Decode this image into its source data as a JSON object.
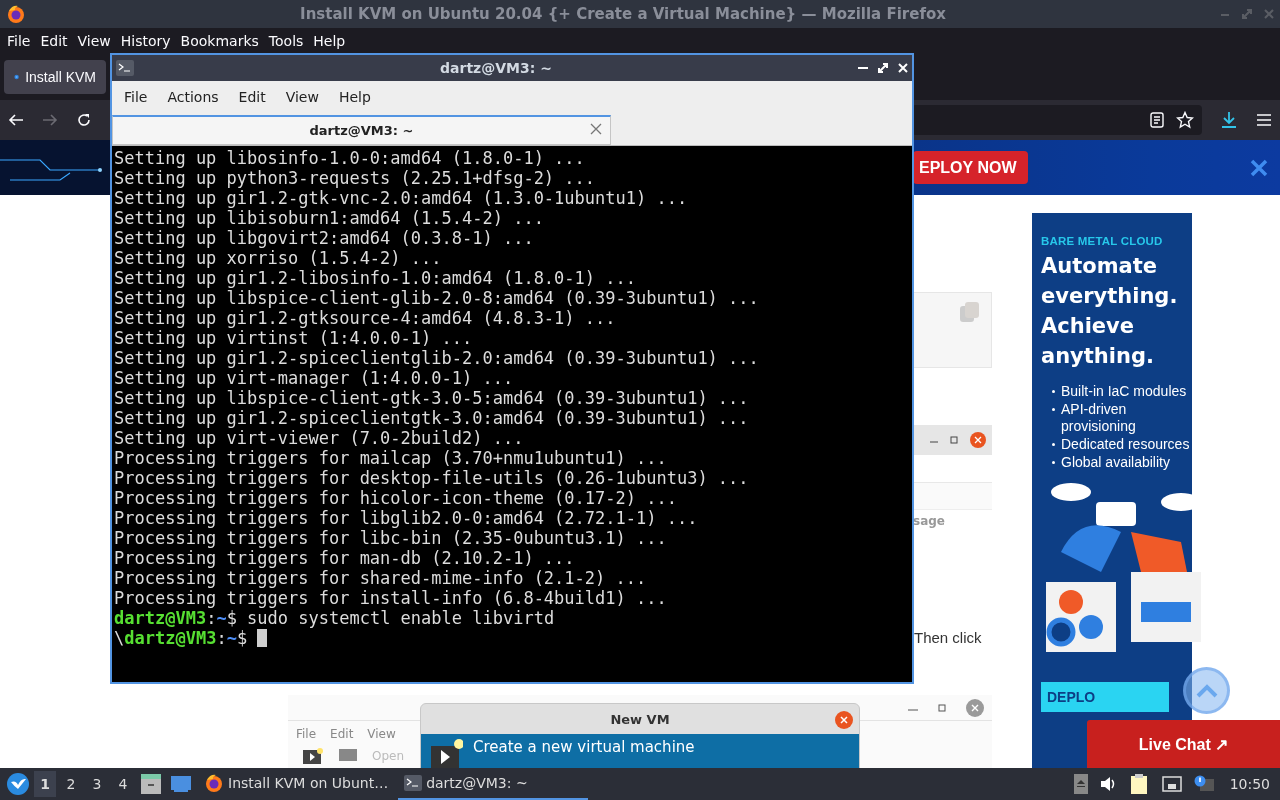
{
  "browser": {
    "title": "Install KVM on Ubuntu 20.04 {+ Create a Virtual Machine} — Mozilla Firefox",
    "menu": [
      "File",
      "Edit",
      "View",
      "History",
      "Bookmarks",
      "Tools",
      "Help"
    ],
    "tabs": [
      {
        "label": "Install KVM",
        "selected": true
      }
    ],
    "nav_buttons": [
      {
        "kind": "back",
        "disabled": false
      },
      {
        "kind": "forward",
        "disabled": true
      },
      {
        "kind": "reload",
        "disabled": false
      }
    ],
    "page": {
      "banner": {
        "button": "EPLOY NOW"
      },
      "article": {
        "partial_word": "sage",
        "partial_sentence": "Then click",
        "screenshot": {
          "menu": [
            "File",
            "Edit",
            "View"
          ],
          "toolbar_label": "Open",
          "dialog": {
            "title": "New VM",
            "option": "Create a new virtual machine"
          }
        }
      },
      "ad": {
        "eyebrow": "BARE METAL CLOUD",
        "headline": "Automate everything. Achieve anything.",
        "bullets": [
          "Built-in IaC modules",
          "API-driven provisioning",
          "Dedicated resources",
          "Global availability"
        ],
        "button": "DEPLO"
      },
      "live_chat": "Live Chat ↗"
    }
  },
  "terminal": {
    "title": "dartz@VM3: ~",
    "menu": [
      "File",
      "Actions",
      "Edit",
      "View",
      "Help"
    ],
    "tabs": [
      {
        "label": "dartz@VM3: ~",
        "selected": true
      }
    ],
    "lines": [
      {
        "kind": "output",
        "text": "Setting up libosinfo-1.0-0:amd64 (1.8.0-1) ..."
      },
      {
        "kind": "output",
        "text": "Setting up python3-requests (2.25.1+dfsg-2) ..."
      },
      {
        "kind": "output",
        "text": "Setting up gir1.2-gtk-vnc-2.0:amd64 (1.3.0-1ubuntu1) ..."
      },
      {
        "kind": "output",
        "text": "Setting up libisoburn1:amd64 (1.5.4-2) ..."
      },
      {
        "kind": "output",
        "text": "Setting up libgovirt2:amd64 (0.3.8-1) ..."
      },
      {
        "kind": "output",
        "text": "Setting up xorriso (1.5.4-2) ..."
      },
      {
        "kind": "output",
        "text": "Setting up gir1.2-libosinfo-1.0:amd64 (1.8.0-1) ..."
      },
      {
        "kind": "output",
        "text": "Setting up libspice-client-glib-2.0-8:amd64 (0.39-3ubuntu1) ..."
      },
      {
        "kind": "output",
        "text": "Setting up gir1.2-gtksource-4:amd64 (4.8.3-1) ..."
      },
      {
        "kind": "output",
        "text": "Setting up virtinst (1:4.0.0-1) ..."
      },
      {
        "kind": "output",
        "text": "Setting up gir1.2-spiceclientglib-2.0:amd64 (0.39-3ubuntu1) ..."
      },
      {
        "kind": "output",
        "text": "Setting up virt-manager (1:4.0.0-1) ..."
      },
      {
        "kind": "output",
        "text": "Setting up libspice-client-gtk-3.0-5:amd64 (0.39-3ubuntu1) ..."
      },
      {
        "kind": "output",
        "text": "Setting up gir1.2-spiceclientgtk-3.0:amd64 (0.39-3ubuntu1) ..."
      },
      {
        "kind": "output",
        "text": "Setting up virt-viewer (7.0-2build2) ..."
      },
      {
        "kind": "output",
        "text": "Processing triggers for mailcap (3.70+nmu1ubuntu1) ..."
      },
      {
        "kind": "output",
        "text": "Processing triggers for desktop-file-utils (0.26-1ubuntu3) ..."
      },
      {
        "kind": "output",
        "text": "Processing triggers for hicolor-icon-theme (0.17-2) ..."
      },
      {
        "kind": "output",
        "text": "Processing triggers for libglib2.0-0:amd64 (2.72.1-1) ..."
      },
      {
        "kind": "output",
        "text": "Processing triggers for libc-bin (2.35-0ubuntu3.1) ..."
      },
      {
        "kind": "output",
        "text": "Processing triggers for man-db (2.10.2-1) ..."
      },
      {
        "kind": "output",
        "text": "Processing triggers for shared-mime-info (2.1-2) ..."
      },
      {
        "kind": "output",
        "text": "Processing triggers for install-info (6.8-4build1) ..."
      },
      {
        "kind": "prompt",
        "cursor": false,
        "segments": [
          {
            "kind": "user",
            "text": "dartz@VM3"
          },
          {
            "kind": "sep",
            "text": ":"
          },
          {
            "kind": "path",
            "text": "~"
          },
          {
            "kind": "plain",
            "text": "$ sudo systemctl enable libvirtd"
          }
        ]
      },
      {
        "kind": "prompt",
        "cursor": true,
        "segments": [
          {
            "kind": "plain",
            "text": "\\"
          },
          {
            "kind": "user",
            "text": "dartz@VM3"
          },
          {
            "kind": "sep",
            "text": ":"
          },
          {
            "kind": "path",
            "text": "~"
          },
          {
            "kind": "plain",
            "text": "$ "
          }
        ]
      }
    ]
  },
  "taskbar": {
    "workspaces": [
      {
        "label": "1",
        "selected": true
      },
      {
        "label": "2",
        "selected": false
      },
      {
        "label": "3",
        "selected": false
      },
      {
        "label": "4",
        "selected": false
      }
    ],
    "tasks": [
      {
        "kind": "browser",
        "label": "Install KVM on Ubunt…",
        "selected": false
      },
      {
        "kind": "terminal",
        "label": "dartz@VM3: ~",
        "selected": true
      }
    ],
    "clock": "10:50"
  }
}
